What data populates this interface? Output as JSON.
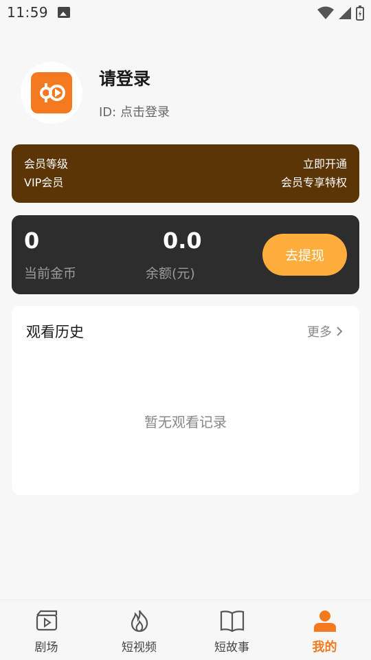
{
  "status_bar": {
    "time": "11:59"
  },
  "profile": {
    "name": "请登录",
    "id_text": "ID: 点击登录"
  },
  "vip": {
    "level_label": "会员等级",
    "level_value": "VIP会员",
    "open_label": "立即开通",
    "benefit_label": "会员专享特权"
  },
  "wallet": {
    "coins_value": "0",
    "coins_label": "当前金币",
    "balance_value": "0.0",
    "balance_label": "余额(元)",
    "withdraw_label": "去提现"
  },
  "history": {
    "title": "观看历史",
    "more_label": "更多",
    "empty_text": "暂无观看记录"
  },
  "nav": {
    "items": [
      {
        "label": "剧场",
        "icon": "theater-icon"
      },
      {
        "label": "短视频",
        "icon": "flame-icon"
      },
      {
        "label": "短故事",
        "icon": "book-icon"
      },
      {
        "label": "我的",
        "icon": "user-icon"
      }
    ],
    "active_index": 3
  },
  "colors": {
    "accent": "#f57a1f",
    "vip_bg": "#5c3506",
    "wallet_bg": "#2d2d2d",
    "withdraw_btn": "#ffad3d"
  }
}
